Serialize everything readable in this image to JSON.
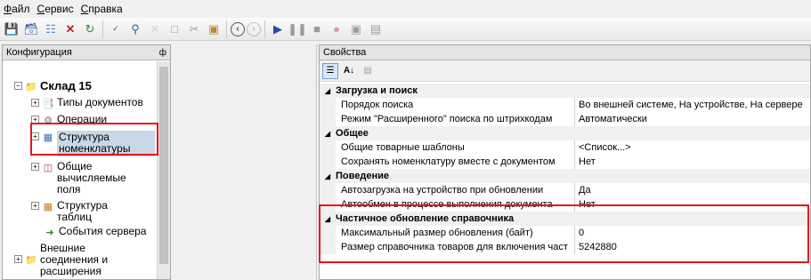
{
  "menu": [
    {
      "first": "Ф",
      "rest": "айл"
    },
    {
      "first": "С",
      "rest": "ервис"
    },
    {
      "first": "С",
      "rest": "правка"
    }
  ],
  "toolbar": {
    "icons": [
      "save-icon",
      "save-all-icon",
      "open-icon",
      "delete-icon",
      "refresh-icon",
      "spellcheck-icon",
      "search-icon",
      "cancel-icon",
      "copy-icon",
      "cut-icon",
      "paste-icon",
      "back-icon",
      "forward-icon",
      "play-icon",
      "pause-icon",
      "stop-icon",
      "record-icon",
      "window-icon",
      "window2-icon"
    ]
  },
  "config_panel": {
    "title": "Конфигурация",
    "pin": "ф",
    "items": [
      {
        "label": "Склад 15",
        "icon": "warehouse-icon",
        "bold": true
      },
      {
        "label": "Типы документов",
        "icon": "documents-icon"
      },
      {
        "label": "Операции",
        "icon": "operations-icon"
      },
      {
        "label": "Структура номенклатуры",
        "icon": "table-icon",
        "selected": true
      },
      {
        "label": "Общие вычисляемые поля",
        "icon": "field-icon"
      },
      {
        "label": "Структура таблиц",
        "icon": "tables-icon"
      },
      {
        "label": "События сервера",
        "icon": "server-events-icon"
      },
      {
        "label": "Внешние соединения и расширения",
        "icon": "external-icon"
      }
    ]
  },
  "properties": {
    "title": "Свойства",
    "categories": [
      {
        "name": "Загрузка и поиск",
        "rows": [
          {
            "name": "Порядок поиска",
            "value": "Во внешней системе, На устройстве, На сервере"
          },
          {
            "name": "Режим \"Расширенного\" поиска по штрихкодам",
            "value": "Автоматически"
          }
        ]
      },
      {
        "name": "Общее",
        "rows": [
          {
            "name": "Общие товарные шаблоны",
            "value": "<Список...>"
          },
          {
            "name": "Сохранять номенклатуру вместе с документом",
            "value": "Нет"
          }
        ]
      },
      {
        "name": "Поведение",
        "rows": [
          {
            "name": "Автозагрузка на устройство при обновлении",
            "value": "Да"
          },
          {
            "name": "Автообмен в процессе выполнения документа",
            "value": "Нет"
          }
        ]
      },
      {
        "name": "Частичное обновление справочника",
        "rows": [
          {
            "name": "Максимальный размер обновления (байт)",
            "value": "0"
          },
          {
            "name": "Размер справочника товаров для включения част",
            "value": "5242880"
          }
        ]
      }
    ]
  },
  "colors": {
    "highlight": "#e8141d",
    "selection": "#c9d8e8"
  }
}
